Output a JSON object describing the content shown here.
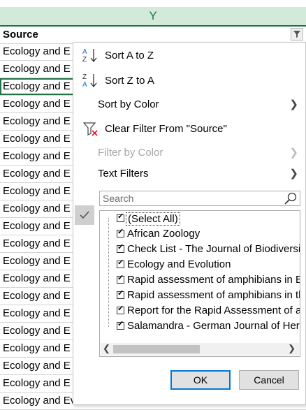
{
  "column_letter": "Y",
  "header_cell": "Source",
  "cells": [
    "Ecology and E",
    "Ecology and E",
    "Ecology and E",
    "Ecology and E",
    "Ecology and E",
    "Ecology and E",
    "Ecology and E",
    "Ecology and E",
    "Ecology and E",
    "Ecology and E",
    "Ecology and E",
    "Ecology and E",
    "Ecology and E",
    "Ecology and E",
    "Ecology and E",
    "Ecology and E",
    "Ecology and E",
    "Ecology and E",
    "Ecology and E",
    "Ecology and E",
    "Ecology and Evolution"
  ],
  "menu": {
    "sort_az": "Sort A to Z",
    "sort_za": "Sort Z to A",
    "sort_by_color": "Sort by Color",
    "clear_filter": "Clear Filter From \"Source\"",
    "filter_by_color": "Filter by Color",
    "text_filters": "Text Filters",
    "search_placeholder": "Search",
    "items": [
      "(Select All)",
      "African Zoology",
      "Check List - The Journal of Biodiversit",
      "Ecology and Evolution",
      "Rapid assessment of amphibians in B",
      "Rapid assessment of amphibians in th",
      "Report for the Rapid Assessment of a",
      "Salamandra - German Journal of Herp"
    ],
    "ok_label": "OK",
    "cancel_label": "Cancel"
  },
  "colors": {
    "excel_green": "#217346",
    "ok_border": "#0078d7",
    "clear_filter_x": "#e81123"
  }
}
